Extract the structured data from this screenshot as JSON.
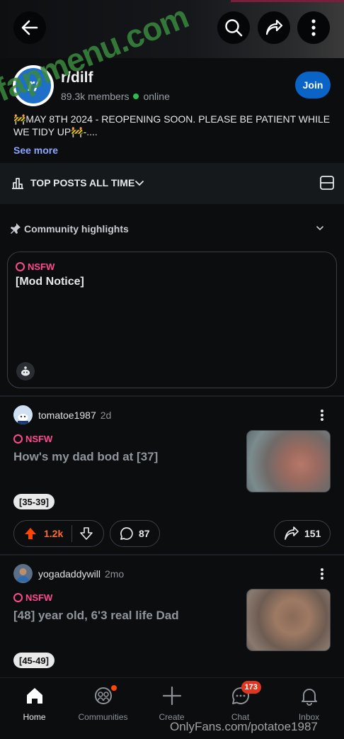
{
  "subreddit": {
    "name": "r/dilf",
    "avatar_text": "r/",
    "members": "89.3k members",
    "online": "online",
    "join_label": "Join",
    "description": "🚧MAY 8TH 2024 - REOPENING SOON. PLEASE BE PATIENT WHILE WE TIDY UP🚧-....",
    "see_more": "See more"
  },
  "watermark_text": "fapmenu.com",
  "sort": {
    "label": "TOP POSTS ALL TIME"
  },
  "highlights": {
    "title": "Community highlights",
    "card": {
      "tag": "NSFW",
      "title": "[Mod Notice]"
    }
  },
  "posts": [
    {
      "username": "tomatoe1987",
      "time": "2d",
      "tag": "NSFW",
      "title": "How's my dad bod at [37]",
      "flair": "[35-39]",
      "upvotes": "1.2k",
      "comments": "87",
      "shares": "151"
    },
    {
      "username": "yogadaddywill",
      "time": "2mo",
      "tag": "NSFW",
      "title": "[48] year old, 6'3 real life Dad",
      "flair": "[45-49]"
    }
  ],
  "nav": {
    "items": [
      {
        "label": "Home"
      },
      {
        "label": "Communities"
      },
      {
        "label": "Create"
      },
      {
        "label": "Chat",
        "badge": "173"
      },
      {
        "label": "Inbox"
      }
    ]
  },
  "footer_watermark": "OnlyFans.com/potatoe1987",
  "colors": {
    "accent": "#0a63c6",
    "nsfw": "#ff4a8e",
    "upvote": "#ff4500",
    "online": "#2dbd4e"
  }
}
